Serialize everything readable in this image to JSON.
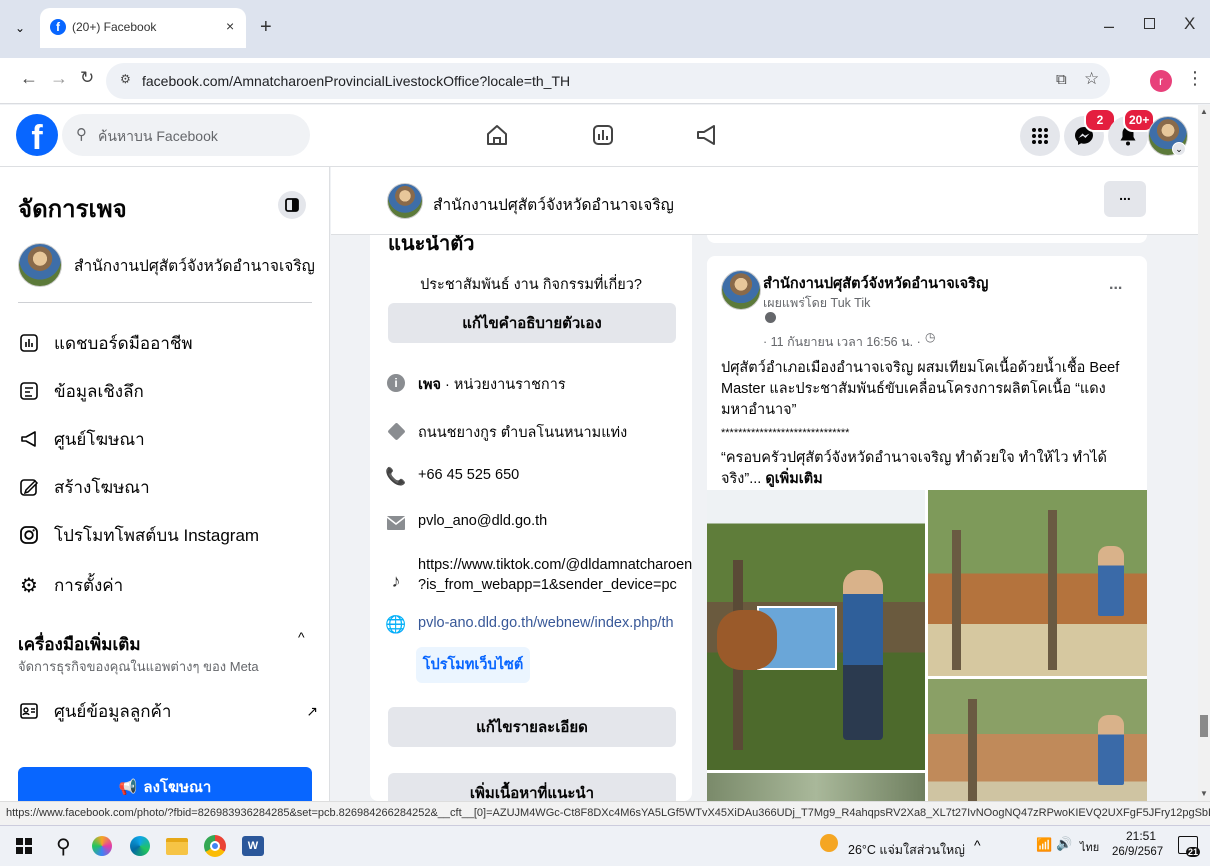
{
  "browser": {
    "tab_title": "(20+) Facebook",
    "url": "facebook.com/AmnatcharoenProvincialLivestockOffice?locale=th_TH",
    "profile_initial": "r"
  },
  "fb": {
    "search_placeholder": "ค้นหาบน Facebook",
    "messenger_badge": "2",
    "notif_badge": "20+"
  },
  "sidebar": {
    "title": "จัดการเพจ",
    "page_name": "สำนักงานปศุสัตว์จังหวัดอำนาจเจริญ",
    "items": [
      {
        "label": "แดชบอร์ดมืออาชีพ",
        "icon": "dashboard-icon"
      },
      {
        "label": "ข้อมูลเชิงลึก",
        "icon": "insights-icon"
      },
      {
        "label": "ศูนย์โฆษณา",
        "icon": "megaphone-icon"
      },
      {
        "label": "สร้างโฆษณา",
        "icon": "edit-icon"
      },
      {
        "label": "โปรโมทโพสต์บน Instagram",
        "icon": "instagram-icon"
      },
      {
        "label": "การตั้งค่า",
        "icon": "gear-icon"
      }
    ],
    "tools_title": "เครื่องมือเพิ่มเติม",
    "tools_sub": "จัดการธุรกิจของคุณในแอพต่างๆ ของ Meta",
    "tools_item": "ศูนย์ข้อมูลลูกค้า",
    "promote_button": "ลงโฆษณา"
  },
  "page_header": {
    "name": "สำนักงานปศุสัตว์จังหวัดอำนาจเจริญ",
    "more": "..."
  },
  "intro": {
    "heading": "แนะนำตัว",
    "bio": "ประชาสัมพันธ์ งาน กิจกรรมที่เกี่ยว?",
    "edit_bio_button": "แก้ไขคำอธิบายตัวเอง",
    "category_bold": "เพจ",
    "category_rest": " · หน่วยงานราชการ",
    "address": "ถนนชยางกูร ตำบลโนนหนามแท่ง",
    "phone": "+66 45 525 650",
    "email": "pvlo_ano@dld.go.th",
    "tiktok_line1": "https://www.tiktok.com/@dldamnatcharoen",
    "tiktok_line2": "?is_from_webapp=1&sender_device=pc",
    "website": "pvlo-ano.dld.go.th/webnew/index.php/th",
    "promote_site_button": "โปรโมทเว็บไซต์",
    "edit_details_button": "แก้ไขรายละเอียด",
    "add_featured_button": "เพิ่มเนื้อหาที่แนะนำ"
  },
  "post": {
    "author": "สำนักงานปศุสัตว์จังหวัดอำนาจเจริญ",
    "published_by": "เผยแพร่โดย Tuk Tik",
    "date": "· 11 กันยายน เวลา 16:56 น. ·",
    "more": "...",
    "text1": "ปศุสัตว์อำเภอเมืองอำนาจเจริญ ผสมเทียมโคเนื้อด้วยน้ำเชื้อ Beef Master และประชาสัมพันธ์ขับเคลื่อนโครงการผลิตโคเนื้อ “แดงมหาอำนาจ”",
    "stars": "******************************",
    "text2": "“ครอบครัวปศุสัตว์จังหวัดอำนาจเจริญ ทำด้วยใจ ทำให้ไว ทำได้จริง”...",
    "see_more": "ดูเพิ่มเติม"
  },
  "status_url": "https://www.facebook.com/photo/?fbid=826983936284285&set=pcb.826984266284252&__cft__[0]=AZUJM4WGc-Ct8F8DXc4M6sYA5LGf5WTvX45XiDAu366UDj_T7Mg9_R4ahqpsRV2Xa8_XL7t27IvNOogNQ47zRPwoKIEVQ2UXFgF5JFry12pgSbD8o179I...",
  "taskbar": {
    "weather": "26°C แจ่มใสส่วนใหญ่",
    "lang": "ไทย",
    "time": "21:51",
    "date": "26/9/2567",
    "notif_count": "21"
  },
  "colors": {
    "fb_blue": "#0866ff",
    "link_blue": "#385898"
  }
}
